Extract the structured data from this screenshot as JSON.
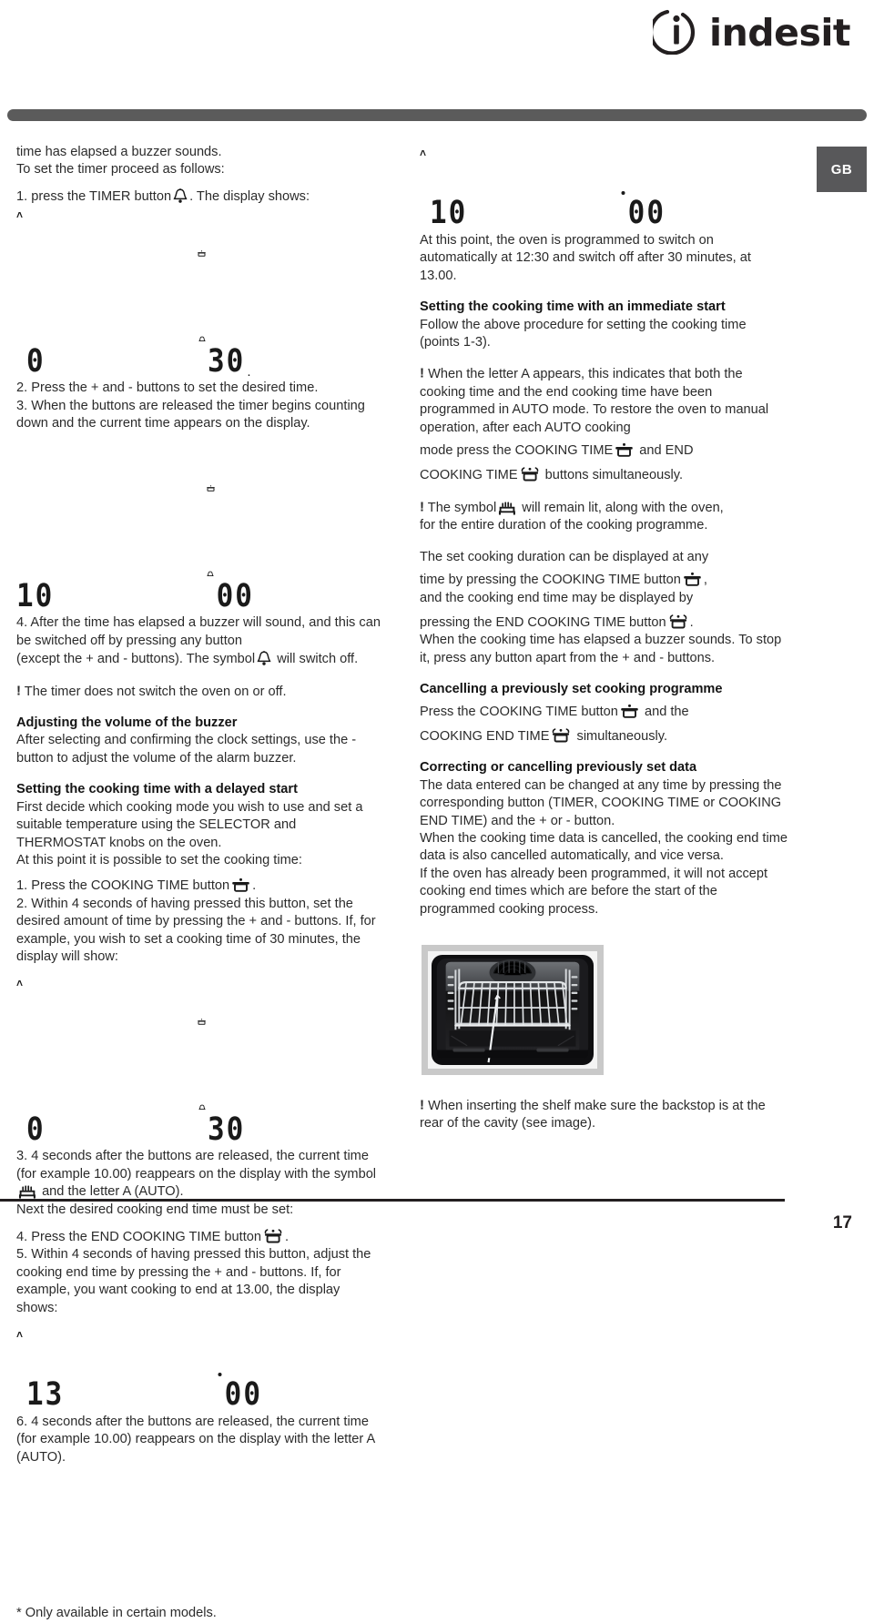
{
  "brand": {
    "logo_icon": "indesit-i-circle-icon",
    "name_lower": "inde",
    "name_mid": "s",
    "name_end": "it"
  },
  "lang_badge": {
    "label": "GB"
  },
  "footer": {
    "page_number": "17"
  },
  "left_column": {
    "intro_line1": "time has elapsed a buzzer sounds.",
    "intro_line2": "To set the timer proceed as follows:",
    "step1_pre": "1. press the TIMER button",
    "step1_post": ". The display shows:",
    "lcd_1": {
      "auto": "˄",
      "value": "0",
      "sep_symbols": "□",
      "value2": "30",
      "trail": "."
    },
    "step2": "2. Press the + and - buttons to set the desired time.",
    "step3": "3. When the buttons are released the timer begins counting down and the current time appears on the display.",
    "lcd_2": {
      "value": "10",
      "value2": "00"
    },
    "step4": "4. After the time has elapsed a buzzer will sound, and this can be switched off by pressing any button",
    "step4b_pre": "(except the + and - buttons). The symbol",
    "step4b_post": "will switch off.",
    "note1": "The timer does not switch the oven on or off.",
    "heading_volume": "Adjusting the volume of the buzzer",
    "volume_body": "After selecting and confirming the clock settings, use the - button to adjust the volume of the alarm buzzer.",
    "heading_delayed": "Setting the cooking time with a delayed start",
    "delayed_body1": "First decide which cooking mode you wish to use and set a suitable temperature using the SELECTOR and THERMOSTAT knobs on the oven.",
    "delayed_body2": "At this point it is possible to set the cooking time:",
    "d_step1_pre": "1. Press the COOKING TIME button",
    "d_step1_post": ".",
    "d_step2": "2. Within 4 seconds of having pressed this button, set the desired amount of time by pressing the + and - buttons. If, for example, you wish to set a cooking time of 30 minutes, the display will show:",
    "lcd_3": {
      "auto": "˄",
      "value": "0",
      "value2": "30"
    },
    "d_step3_a": "3. 4 seconds after the buttons are released, the current time (for example 10.00) reappears on the display with the symbol",
    "d_step3_b": "and the letter A (AUTO).",
    "d_step3_c": "Next the desired cooking end time must be set:",
    "d_step4_pre": "4. Press the END COOKING TIME button",
    "d_step4_post": ".",
    "d_step5": "5. Within 4 seconds of having pressed this button, adjust the cooking end time by pressing the + and - buttons. If, for example, you want cooking to end at 13.00, the display shows:",
    "lcd_4": {
      "auto": "˄",
      "value": "13",
      "value2": "00"
    },
    "d_step6": "6. 4 seconds after the buttons are released, the current time (for example 10.00) reappears on the display with the letter A (AUTO).",
    "footnote": "* Only available in certain models."
  },
  "right_column": {
    "lcd_1": {
      "auto": "˄",
      "value": "10",
      "value2": "00"
    },
    "para1": "At this point, the oven is programmed to switch on automatically at 12:30 and switch off after 30 minutes, at 13.00.",
    "heading_immediate": "Setting the cooking time with an immediate start",
    "immediate_body": "Follow the above procedure for setting the cooking time (points 1-3).",
    "note_auto_a": "When the letter A appears, this indicates that both the cooking time and the end cooking time have been programmed in AUTO mode. To restore the oven to manual operation, after each AUTO cooking",
    "note_auto_b_pre": "mode press the COOKING TIME",
    "note_auto_b_mid": "and END",
    "note_auto_c_pre": "COOKING TIME",
    "note_auto_c_post": "buttons simultaneously.",
    "note_symbol_pre": "The symbol",
    "note_symbol_mid": "will remain lit, along with the oven,",
    "note_symbol_post": "for the entire duration of the cooking programme.",
    "duration_a": "The set cooking duration can be displayed at any",
    "duration_b_pre": "time by pressing the COOKING TIME button",
    "duration_b_post": ",",
    "duration_c": "and the cooking end time may be displayed by",
    "duration_d_pre": "pressing the END COOKING TIME button",
    "duration_d_post": ".",
    "duration_e": "When the cooking time has elapsed a buzzer sounds. To stop it, press any button apart from the + and - buttons.",
    "heading_cancelling": "Cancelling a previously set cooking programme",
    "cancel_a_pre": "Press the COOKING TIME button",
    "cancel_a_post": "and the",
    "cancel_b_pre": "COOKING END TIME",
    "cancel_b_post": "simultaneously.",
    "heading_correcting": "Correcting or cancelling previously set data",
    "correcting_body1": "The data entered can be changed at any time by pressing the corresponding button (TIMER, COOKING TIME or COOKING END TIME) and the + or - button.",
    "correcting_body2": "When the cooking time data is cancelled, the cooking end time data is also cancelled automatically, and vice versa.",
    "correcting_body3": "If the oven has already been programmed, it will not accept cooking end times which are before the start of the programmed cooking process.",
    "oven_image_alt": "oven-cavity-with-shelf-photo",
    "note_shelf": "When inserting the shelf make sure the backstop is at the rear of the cavity (see image)."
  },
  "icons": {
    "timer_bell": "bell-icon",
    "cooking_time_pot": "pot-icon",
    "end_cooking_time_pot": "pot-with-steam-icon",
    "auto_cooking": "oven-heat-icon"
  },
  "colors": {
    "text": "#2b2b2b",
    "heading": "#141414",
    "rule_bar": "#5b5b5b",
    "badge_bg": "#58585a",
    "badge_text": "#ffffff",
    "footer_rule": "#231f20"
  },
  "bang": "!"
}
